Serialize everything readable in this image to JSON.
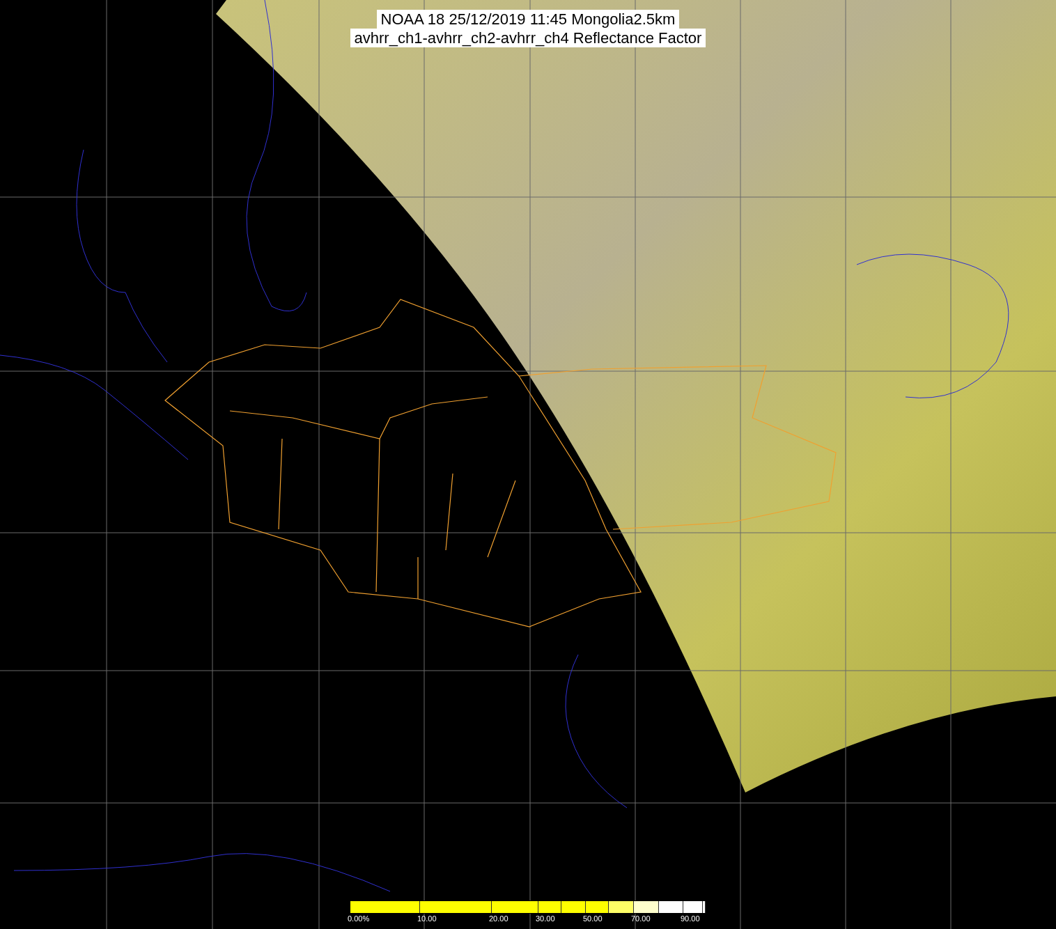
{
  "title": {
    "lines": [
      "NOAA 18 25/12/2019 11:45 Mongolia2.5km",
      "avhrr_ch1-avhrr_ch2-avhrr_ch4 Reflectance Factor"
    ]
  },
  "legend": {
    "segments": [
      {
        "color": "#ffff00",
        "label": "0.00%"
      },
      {
        "color": "#ffff00",
        "label": "10.00"
      },
      {
        "color": "#ffff00",
        "label": "20.00"
      },
      {
        "color": "#ffff00",
        "label": "30.00"
      },
      {
        "color": "#ffff00"
      },
      {
        "color": "#ffff00",
        "label": "50.00"
      },
      {
        "color": "#ffff66"
      },
      {
        "color": "#ffffcc",
        "label": "70.00"
      },
      {
        "color": "#ffffff"
      },
      {
        "color": "#ffffff",
        "label": "90.00"
      },
      {
        "color": "#ffffff"
      }
    ]
  }
}
